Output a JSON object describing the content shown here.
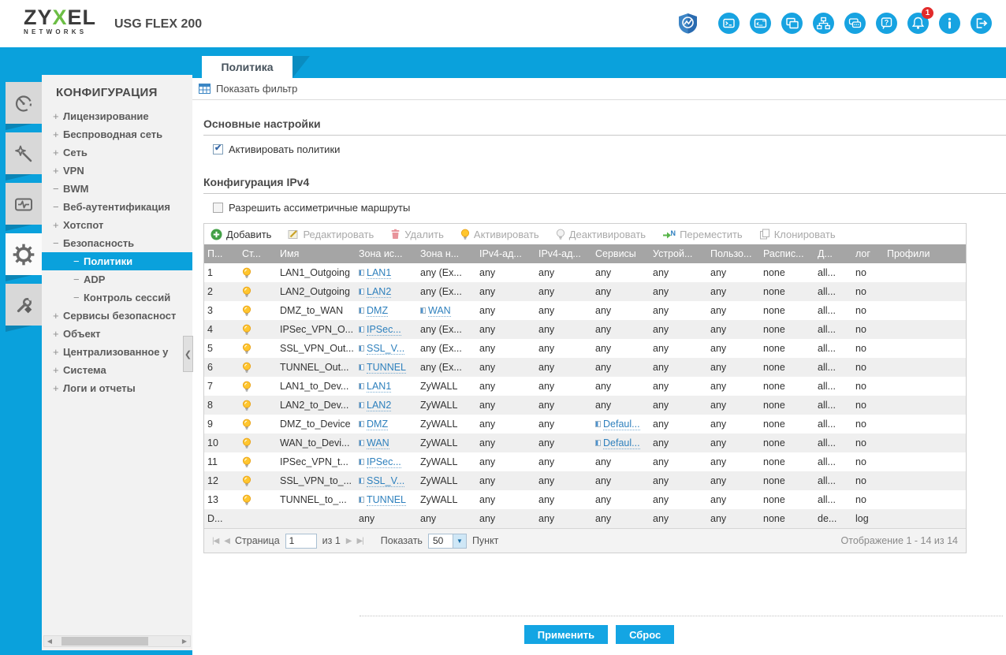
{
  "header": {
    "brand_zy": "ZY",
    "brand_x": "X",
    "brand_el": "EL",
    "brand_sub": "NETWORKS",
    "model": "USG FLEX 200",
    "notification_badge": "1",
    "icons": [
      "secureporter",
      "web-console",
      "cli",
      "reference",
      "site-map",
      "forum",
      "help",
      "notification",
      "about",
      "logout"
    ]
  },
  "sidebar": {
    "title": "КОНФИГУРАЦИЯ",
    "items": [
      {
        "prefix": "+",
        "label": "Лицензирование",
        "child": false,
        "selected": false
      },
      {
        "prefix": "+",
        "label": "Беспроводная сеть",
        "child": false,
        "selected": false
      },
      {
        "prefix": "+",
        "label": "Сеть",
        "child": false,
        "selected": false
      },
      {
        "prefix": "+",
        "label": "VPN",
        "child": false,
        "selected": false
      },
      {
        "prefix": "−",
        "label": "BWM",
        "child": false,
        "selected": false
      },
      {
        "prefix": "−",
        "label": "Веб-аутентификация",
        "child": false,
        "selected": false
      },
      {
        "prefix": "+",
        "label": "Хотспот",
        "child": false,
        "selected": false
      },
      {
        "prefix": "−",
        "label": "Безопасность",
        "child": false,
        "selected": false
      },
      {
        "prefix": "−",
        "label": "Политики",
        "child": true,
        "selected": true
      },
      {
        "prefix": "−",
        "label": "ADP",
        "child": true,
        "selected": false
      },
      {
        "prefix": "−",
        "label": "Контроль сессий",
        "child": true,
        "selected": false
      },
      {
        "prefix": "+",
        "label": "Сервисы безопасност",
        "child": false,
        "selected": false
      },
      {
        "prefix": "+",
        "label": "Объект",
        "child": false,
        "selected": false
      },
      {
        "prefix": "+",
        "label": "Централизованное у",
        "child": false,
        "selected": false
      },
      {
        "prefix": "+",
        "label": "Система",
        "child": false,
        "selected": false
      },
      {
        "prefix": "+",
        "label": "Логи и отчеты",
        "child": false,
        "selected": false
      }
    ]
  },
  "tab": {
    "label": "Политика"
  },
  "filter": {
    "label": "Показать фильтр"
  },
  "sections": {
    "general": {
      "title": "Основные настройки",
      "checkbox": {
        "label": "Активировать политики",
        "checked": true
      }
    },
    "ipv4": {
      "title": "Конфигурация IPv4",
      "checkbox": {
        "label": "Разрешить ассиметричные маршруты",
        "checked": false
      }
    }
  },
  "toolbar": {
    "add": "Добавить",
    "edit": "Редактировать",
    "delete": "Удалить",
    "activate": "Активировать",
    "deactivate": "Деактивировать",
    "move": "Переместить",
    "clone": "Клонировать"
  },
  "table": {
    "columns": [
      "П...",
      "Ст...",
      "Имя",
      "Зона ис...",
      "Зона н...",
      "IPv4-ад...",
      "IPv4-ад...",
      "Сервисы",
      "Устрой...",
      "Пользо...",
      "Распис...",
      "Д...",
      "лог",
      "Профили"
    ],
    "rows": [
      {
        "priority": "1",
        "status": "on",
        "name": "LAN1_Outgoing",
        "from": "LAN1",
        "from_link": true,
        "to": "any (Ex...",
        "to_link": false,
        "ipv4_src": "any",
        "ipv4_dst": "any",
        "service": "any",
        "service_link": false,
        "device": "any",
        "user": "any",
        "schedule": "none",
        "action": "all...",
        "log": "no",
        "profile": ""
      },
      {
        "priority": "2",
        "status": "on",
        "name": "LAN2_Outgoing",
        "from": "LAN2",
        "from_link": true,
        "to": "any (Ex...",
        "to_link": false,
        "ipv4_src": "any",
        "ipv4_dst": "any",
        "service": "any",
        "service_link": false,
        "device": "any",
        "user": "any",
        "schedule": "none",
        "action": "all...",
        "log": "no",
        "profile": ""
      },
      {
        "priority": "3",
        "status": "on",
        "name": "DMZ_to_WAN",
        "from": "DMZ",
        "from_link": true,
        "to": "WAN",
        "to_link": true,
        "ipv4_src": "any",
        "ipv4_dst": "any",
        "service": "any",
        "service_link": false,
        "device": "any",
        "user": "any",
        "schedule": "none",
        "action": "all...",
        "log": "no",
        "profile": ""
      },
      {
        "priority": "4",
        "status": "on",
        "name": "IPSec_VPN_O...",
        "from": "IPSec...",
        "from_link": true,
        "to": "any (Ex...",
        "to_link": false,
        "ipv4_src": "any",
        "ipv4_dst": "any",
        "service": "any",
        "service_link": false,
        "device": "any",
        "user": "any",
        "schedule": "none",
        "action": "all...",
        "log": "no",
        "profile": ""
      },
      {
        "priority": "5",
        "status": "on",
        "name": "SSL_VPN_Out...",
        "from": "SSL_V...",
        "from_link": true,
        "to": "any (Ex...",
        "to_link": false,
        "ipv4_src": "any",
        "ipv4_dst": "any",
        "service": "any",
        "service_link": false,
        "device": "any",
        "user": "any",
        "schedule": "none",
        "action": "all...",
        "log": "no",
        "profile": ""
      },
      {
        "priority": "6",
        "status": "on",
        "name": "TUNNEL_Out...",
        "from": "TUNNEL",
        "from_link": true,
        "to": "any (Ex...",
        "to_link": false,
        "ipv4_src": "any",
        "ipv4_dst": "any",
        "service": "any",
        "service_link": false,
        "device": "any",
        "user": "any",
        "schedule": "none",
        "action": "all...",
        "log": "no",
        "profile": ""
      },
      {
        "priority": "7",
        "status": "on",
        "name": "LAN1_to_Dev...",
        "from": "LAN1",
        "from_link": true,
        "to": "ZyWALL",
        "to_link": false,
        "ipv4_src": "any",
        "ipv4_dst": "any",
        "service": "any",
        "service_link": false,
        "device": "any",
        "user": "any",
        "schedule": "none",
        "action": "all...",
        "log": "no",
        "profile": ""
      },
      {
        "priority": "8",
        "status": "on",
        "name": "LAN2_to_Dev...",
        "from": "LAN2",
        "from_link": true,
        "to": "ZyWALL",
        "to_link": false,
        "ipv4_src": "any",
        "ipv4_dst": "any",
        "service": "any",
        "service_link": false,
        "device": "any",
        "user": "any",
        "schedule": "none",
        "action": "all...",
        "log": "no",
        "profile": ""
      },
      {
        "priority": "9",
        "status": "on",
        "name": "DMZ_to_Device",
        "from": "DMZ",
        "from_link": true,
        "to": "ZyWALL",
        "to_link": false,
        "ipv4_src": "any",
        "ipv4_dst": "any",
        "service": "Defaul...",
        "service_link": true,
        "device": "any",
        "user": "any",
        "schedule": "none",
        "action": "all...",
        "log": "no",
        "profile": ""
      },
      {
        "priority": "10",
        "status": "on",
        "name": "WAN_to_Devi...",
        "from": "WAN",
        "from_link": true,
        "to": "ZyWALL",
        "to_link": false,
        "ipv4_src": "any",
        "ipv4_dst": "any",
        "service": "Defaul...",
        "service_link": true,
        "device": "any",
        "user": "any",
        "schedule": "none",
        "action": "all...",
        "log": "no",
        "profile": ""
      },
      {
        "priority": "11",
        "status": "on",
        "name": "IPSec_VPN_t...",
        "from": "IPSec...",
        "from_link": true,
        "to": "ZyWALL",
        "to_link": false,
        "ipv4_src": "any",
        "ipv4_dst": "any",
        "service": "any",
        "service_link": false,
        "device": "any",
        "user": "any",
        "schedule": "none",
        "action": "all...",
        "log": "no",
        "profile": ""
      },
      {
        "priority": "12",
        "status": "on",
        "name": "SSL_VPN_to_...",
        "from": "SSL_V...",
        "from_link": true,
        "to": "ZyWALL",
        "to_link": false,
        "ipv4_src": "any",
        "ipv4_dst": "any",
        "service": "any",
        "service_link": false,
        "device": "any",
        "user": "any",
        "schedule": "none",
        "action": "all...",
        "log": "no",
        "profile": ""
      },
      {
        "priority": "13",
        "status": "on",
        "name": "TUNNEL_to_...",
        "from": "TUNNEL",
        "from_link": true,
        "to": "ZyWALL",
        "to_link": false,
        "ipv4_src": "any",
        "ipv4_dst": "any",
        "service": "any",
        "service_link": false,
        "device": "any",
        "user": "any",
        "schedule": "none",
        "action": "all...",
        "log": "no",
        "profile": ""
      },
      {
        "priority": "D...",
        "status": "",
        "name": "",
        "from": "any",
        "from_link": false,
        "to": "any",
        "to_link": false,
        "ipv4_src": "any",
        "ipv4_dst": "any",
        "service": "any",
        "service_link": false,
        "device": "any",
        "user": "any",
        "schedule": "none",
        "action": "de...",
        "log": "log",
        "profile": ""
      }
    ]
  },
  "pager": {
    "page_label": "Страница",
    "page_value": "1",
    "of_label": "из 1",
    "show_label": "Показать",
    "page_size": "50",
    "item_label": "Пункт",
    "range": "Отображение 1 - 14 из 14"
  },
  "footer": {
    "apply": "Применить",
    "reset": "Сброс"
  },
  "colors": {
    "accent_blue": "#0aa1dc",
    "brand_green": "#6cbe45",
    "header_gray": "#a5a5a5",
    "badge_red": "#e22b2b"
  }
}
